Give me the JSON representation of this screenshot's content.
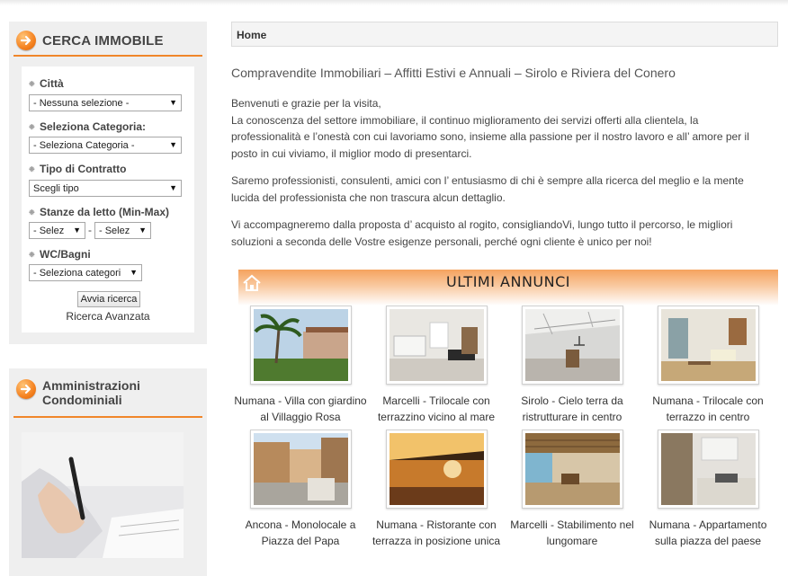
{
  "search_box": {
    "title": "CERCA IMMOBILE",
    "fields": [
      {
        "label": "Città",
        "value": "- Nessuna selezione -"
      },
      {
        "label": "Seleziona Categoria:",
        "value": "- Seleziona Categoria -"
      },
      {
        "label": "Tipo di Contratto",
        "value": "Scegli tipo"
      },
      {
        "label": "Stanze da letto (Min-Max)",
        "value_min": "- Selez",
        "value_max": "- Selez"
      },
      {
        "label": "WC/Bagni",
        "value": "- Seleziona categori"
      }
    ],
    "range_separator": "-",
    "submit_label": "Avvia ricerca",
    "advanced_link": "Ricerca Avanzata"
  },
  "admin_box": {
    "title_line1": "Amministrazioni",
    "title_line2": "Condominiali"
  },
  "breadcrumb": "Home",
  "heading": "Compravendite Immobiliari – Affitti Estivi e Annuali – Sirolo e Riviera del Conero",
  "intro": {
    "line1": "Benvenuti e grazie per la visita,",
    "p1": "La conoscenza del settore immobiliare, il continuo miglioramento dei servizi offerti alla clientela, la professionalità e l’onestà con cui lavoriamo sono, insieme alla passione per il nostro lavoro e all’ amore per il posto in cui viviamo, il miglior modo di presentarci.",
    "p2": "Saremo professionisti, consulenti, amici con l’ entusiasmo di chi è sempre alla ricerca del meglio e la mente lucida del professionista che non trascura alcun dettaglio.",
    "p3": "Vi accompagneremo dalla proposta d’ acquisto al rogito, consigliandoVi, lungo tutto il percorso, le migliori soluzioni a seconda delle Vostre esigenze personali, perché ogni cliente è unico per noi!"
  },
  "annunci": {
    "title": "ULTIMI ANNUNCI",
    "items": [
      {
        "caption": "Numana - Villa con giardino al Villaggio Rosa"
      },
      {
        "caption": "Marcelli - Trilocale con terrazzino vicino al mare"
      },
      {
        "caption": "Sirolo - Cielo terra da ristrutturare in centro"
      },
      {
        "caption": "Numana - Trilocale con terrazzo in centro"
      },
      {
        "caption": "Ancona - Monolocale a Piazza del Papa"
      },
      {
        "caption": "Numana - Ristorante con terrazza in posizione unica"
      },
      {
        "caption": "Marcelli - Stabilimento nel lungomare"
      },
      {
        "caption": "Numana - Appartamento sulla piazza del paese"
      }
    ]
  },
  "colors": {
    "accent": "#f0862a",
    "panel": "#efefef"
  },
  "icons": [
    "arrow-right-circle-icon",
    "home-icon",
    "dropdown-caret-icon",
    "bullet-icon"
  ]
}
